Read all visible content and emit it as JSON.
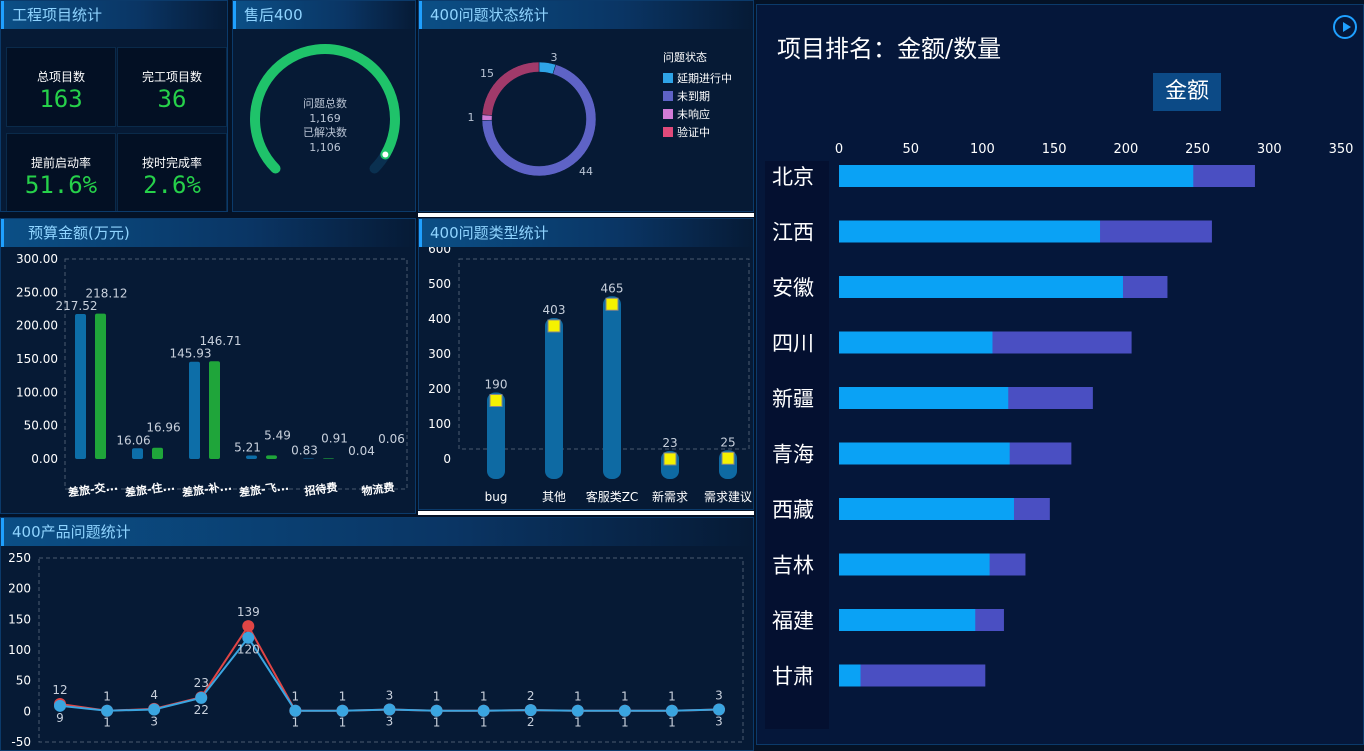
{
  "project_stats": {
    "title": "工程项目统计",
    "total_label": "总项目数",
    "total_value": "163",
    "done_label": "完工项目数",
    "done_value": "36",
    "early_label": "提前启动率",
    "early_value": "51.6%",
    "ontime_label": "按时完成率",
    "ontime_value": "2.6%"
  },
  "aftersale": {
    "title": "售后400",
    "line1": "问题总数",
    "line2": "1,169",
    "line3": "已解决数",
    "line4": "1,106",
    "progress": 0.946,
    "accent": "#1fc36a"
  },
  "status_chart": {
    "title": "400问题状态统计",
    "legend_title": "问题状态",
    "chart_data": {
      "type": "pie",
      "slices": [
        {
          "name": "延期进行中",
          "value": 3,
          "color": "#2fa4e7"
        },
        {
          "name": "未到期",
          "value": 44,
          "color": "#5e63c6"
        },
        {
          "name": "未响应",
          "value": 1,
          "color": "#d17bd6"
        },
        {
          "name": "验证中",
          "value": 15,
          "color": "#a13a6a"
        }
      ]
    }
  },
  "budget": {
    "title": "预算金额(万元)",
    "chart_data": {
      "type": "bar",
      "categories": [
        "差旅-交...",
        "差旅-住...",
        "差旅-补...",
        "差旅-飞...",
        "招待费",
        "物流费"
      ],
      "series": [
        {
          "values": [
            217.52,
            16.06,
            145.93,
            5.21,
            0.83,
            0.04
          ],
          "labels": [
            "217.52",
            "16.06",
            "145.93",
            "5.21",
            "0.83",
            "0.04"
          ],
          "color": "#0d6ea8"
        },
        {
          "values": [
            218.12,
            16.96,
            146.71,
            5.49,
            0.91,
            0.06
          ],
          "labels": [
            "218.12",
            "16.96",
            "146.71",
            "5.49",
            "0.91",
            "0.06"
          ],
          "color": "#1fa53a"
        }
      ],
      "yticks": [
        "300.00",
        "250.00",
        "200.00",
        "150.00",
        "100.00",
        "50.00",
        "0.00"
      ],
      "ylim": [
        0,
        300
      ]
    }
  },
  "type_chart": {
    "title": "400问题类型统计",
    "chart_data": {
      "type": "bar",
      "categories": [
        "bug",
        "其他",
        "客服类ZC",
        "新需求",
        "需求建议"
      ],
      "values": [
        190,
        403,
        465,
        23,
        25
      ],
      "yticks": [
        "600",
        "500",
        "400",
        "300",
        "200",
        "100",
        "0"
      ],
      "ylim": [
        0,
        600
      ]
    }
  },
  "product_chart": {
    "title": "400产品问题统计",
    "chart_data": {
      "type": "line",
      "series": [
        {
          "values": [
            12,
            1,
            4,
            23,
            139,
            1,
            1,
            3,
            1,
            1,
            2,
            1,
            1,
            1,
            3
          ],
          "color": "#e04545"
        },
        {
          "values": [
            9,
            1,
            3,
            22,
            120,
            1,
            1,
            3,
            1,
            1,
            2,
            1,
            1,
            1,
            3
          ],
          "color": "#3aa5e0"
        }
      ],
      "yticks": [
        "250",
        "200",
        "150",
        "100",
        "50",
        "0",
        "-50"
      ],
      "ylim": [
        -50,
        250
      ]
    }
  },
  "ranking": {
    "title": "项目排名：金额/数量",
    "button_label": "金额",
    "chart_data": {
      "type": "bar",
      "categories": [
        "北京",
        "江西",
        "安徽",
        "四川",
        "新疆",
        "青海",
        "西藏",
        "吉林",
        "福建",
        "甘肃"
      ],
      "series": [
        {
          "values": [
            247,
            182,
            198,
            107,
            118,
            119,
            122,
            105,
            95,
            15
          ],
          "color": "#0aa2f5"
        },
        {
          "values": [
            290,
            260,
            229,
            204,
            177,
            162,
            147,
            130,
            115,
            102
          ],
          "color": "#4a4fc2"
        }
      ],
      "xticks": [
        "0",
        "50",
        "100",
        "150",
        "200",
        "250",
        "300",
        "350"
      ],
      "xlim": [
        0,
        350
      ]
    }
  }
}
